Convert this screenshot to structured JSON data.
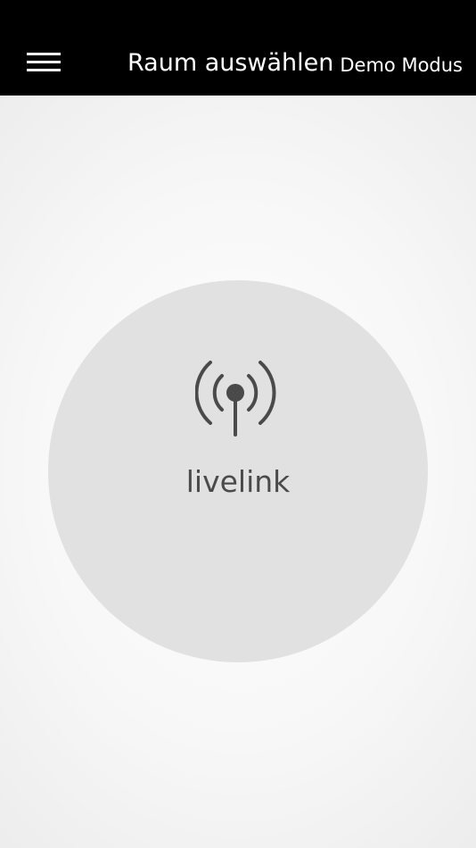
{
  "header": {
    "menu_icon": "hamburger-menu-icon",
    "title": "Raum auswählen",
    "mode_label": "Demo Modus"
  },
  "room": {
    "icon": "antenna-broadcast-icon",
    "label": "livelink"
  },
  "colors": {
    "header_background": "#000000",
    "header_text": "#ffffff",
    "circle_fill": "#e1e1e1",
    "icon_and_label": "#4a4a4a"
  }
}
